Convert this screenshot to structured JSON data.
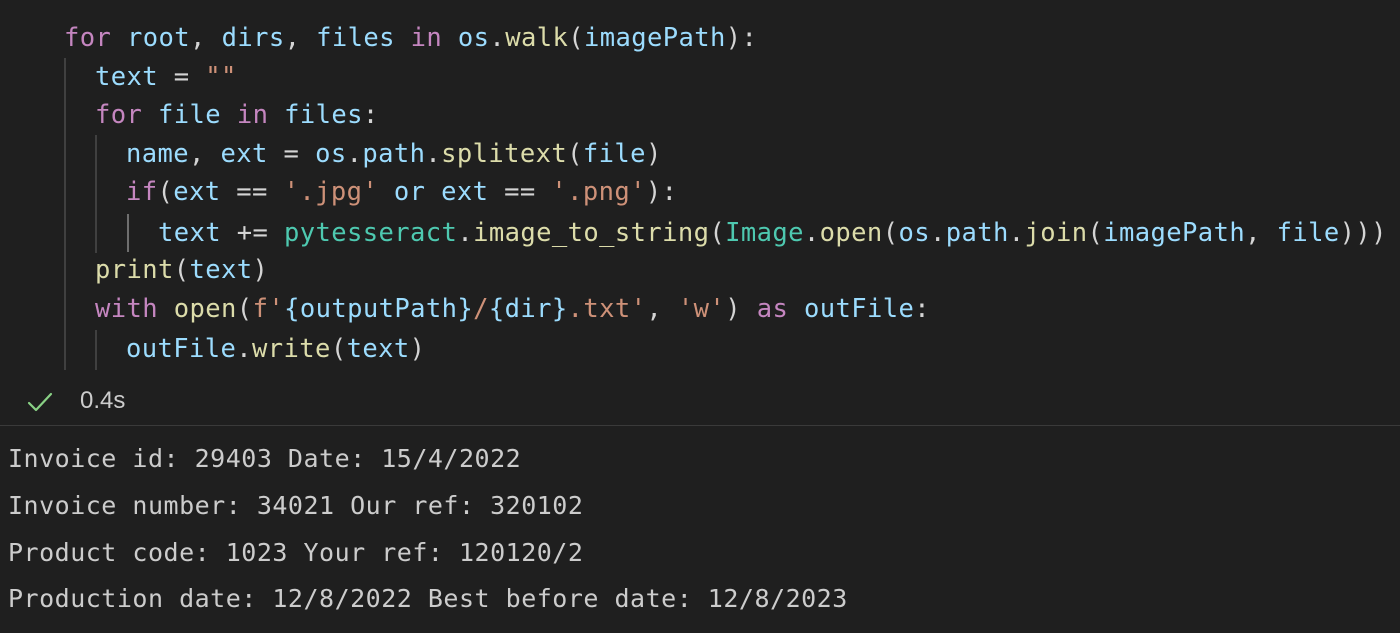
{
  "colors": {
    "background": "#1f1f1f",
    "keyword": "#c586c0",
    "variable": "#9cdcfe",
    "function": "#dcdcaa",
    "string": "#ce9178",
    "class": "#4ec9b0",
    "default": "#d4d4d4",
    "success": "#89d185"
  },
  "code": {
    "lines": [
      [
        {
          "t": "for",
          "c": "keyword"
        },
        {
          "t": " ",
          "c": "default"
        },
        {
          "t": "root",
          "c": "variable"
        },
        {
          "t": ", ",
          "c": "default"
        },
        {
          "t": "dirs",
          "c": "variable"
        },
        {
          "t": ", ",
          "c": "default"
        },
        {
          "t": "files",
          "c": "variable"
        },
        {
          "t": " ",
          "c": "default"
        },
        {
          "t": "in",
          "c": "keyword"
        },
        {
          "t": " ",
          "c": "default"
        },
        {
          "t": "os",
          "c": "variable"
        },
        {
          "t": ".",
          "c": "default"
        },
        {
          "t": "walk",
          "c": "function"
        },
        {
          "t": "(",
          "c": "default"
        },
        {
          "t": "imagePath",
          "c": "variable"
        },
        {
          "t": "):",
          "c": "default"
        }
      ],
      [
        {
          "t": "text",
          "c": "variable"
        },
        {
          "t": " = ",
          "c": "default"
        },
        {
          "t": "\"\"",
          "c": "string"
        }
      ],
      [
        {
          "t": "for",
          "c": "keyword"
        },
        {
          "t": " ",
          "c": "default"
        },
        {
          "t": "file",
          "c": "variable"
        },
        {
          "t": " ",
          "c": "default"
        },
        {
          "t": "in",
          "c": "keyword"
        },
        {
          "t": " ",
          "c": "default"
        },
        {
          "t": "files",
          "c": "variable"
        },
        {
          "t": ":",
          "c": "default"
        }
      ],
      [
        {
          "t": "name",
          "c": "variable"
        },
        {
          "t": ", ",
          "c": "default"
        },
        {
          "t": "ext",
          "c": "variable"
        },
        {
          "t": " = ",
          "c": "default"
        },
        {
          "t": "os",
          "c": "variable"
        },
        {
          "t": ".",
          "c": "default"
        },
        {
          "t": "path",
          "c": "variable"
        },
        {
          "t": ".",
          "c": "default"
        },
        {
          "t": "splitext",
          "c": "function"
        },
        {
          "t": "(",
          "c": "default"
        },
        {
          "t": "file",
          "c": "variable"
        },
        {
          "t": ")",
          "c": "default"
        }
      ],
      [
        {
          "t": "if",
          "c": "keyword"
        },
        {
          "t": "(",
          "c": "default"
        },
        {
          "t": "ext",
          "c": "variable"
        },
        {
          "t": " == ",
          "c": "default"
        },
        {
          "t": "'.jpg'",
          "c": "string"
        },
        {
          "t": " ",
          "c": "default"
        },
        {
          "t": "or",
          "c": "variable"
        },
        {
          "t": " ",
          "c": "default"
        },
        {
          "t": "ext",
          "c": "variable"
        },
        {
          "t": " == ",
          "c": "default"
        },
        {
          "t": "'.png'",
          "c": "string"
        },
        {
          "t": "):",
          "c": "default"
        }
      ],
      [
        {
          "t": "text",
          "c": "variable"
        },
        {
          "t": " += ",
          "c": "default"
        },
        {
          "t": "pytesseract",
          "c": "class"
        },
        {
          "t": ".",
          "c": "default"
        },
        {
          "t": "image_to_string",
          "c": "function"
        },
        {
          "t": "(",
          "c": "default"
        },
        {
          "t": "Image",
          "c": "class"
        },
        {
          "t": ".",
          "c": "default"
        },
        {
          "t": "open",
          "c": "function"
        },
        {
          "t": "(",
          "c": "default"
        },
        {
          "t": "os",
          "c": "variable"
        },
        {
          "t": ".",
          "c": "default"
        },
        {
          "t": "path",
          "c": "variable"
        },
        {
          "t": ".",
          "c": "default"
        },
        {
          "t": "join",
          "c": "function"
        },
        {
          "t": "(",
          "c": "default"
        },
        {
          "t": "imagePath",
          "c": "variable"
        },
        {
          "t": ", ",
          "c": "default"
        },
        {
          "t": "file",
          "c": "variable"
        },
        {
          "t": ")))",
          "c": "default"
        }
      ],
      [
        {
          "t": "print",
          "c": "function"
        },
        {
          "t": "(",
          "c": "default"
        },
        {
          "t": "text",
          "c": "variable"
        },
        {
          "t": ")",
          "c": "default"
        }
      ],
      [
        {
          "t": "with",
          "c": "keyword"
        },
        {
          "t": " ",
          "c": "default"
        },
        {
          "t": "open",
          "c": "function"
        },
        {
          "t": "(",
          "c": "default"
        },
        {
          "t": "f'",
          "c": "string"
        },
        {
          "t": "{outputPath}",
          "c": "variable"
        },
        {
          "t": "/",
          "c": "string"
        },
        {
          "t": "{dir}",
          "c": "variable"
        },
        {
          "t": ".txt'",
          "c": "string"
        },
        {
          "t": ", ",
          "c": "default"
        },
        {
          "t": "'w'",
          "c": "string"
        },
        {
          "t": ") ",
          "c": "default"
        },
        {
          "t": "as",
          "c": "keyword"
        },
        {
          "t": " ",
          "c": "default"
        },
        {
          "t": "outFile",
          "c": "variable"
        },
        {
          "t": ":",
          "c": "default"
        }
      ],
      [
        {
          "t": "outFile",
          "c": "variable"
        },
        {
          "t": ".",
          "c": "default"
        },
        {
          "t": "write",
          "c": "function"
        },
        {
          "t": "(",
          "c": "default"
        },
        {
          "t": "text",
          "c": "variable"
        },
        {
          "t": ")",
          "c": "default"
        }
      ]
    ]
  },
  "execution": {
    "status_icon": "check-icon",
    "duration": "0.4s"
  },
  "output": {
    "lines": [
      "Invoice id: 29403 Date: 15/4/2022",
      "Invoice number: 34021 Our ref: 320102",
      "Product code: 1023 Your ref: 120120/2",
      "Production date: 12/8/2022 Best before date: 12/8/2023"
    ]
  }
}
